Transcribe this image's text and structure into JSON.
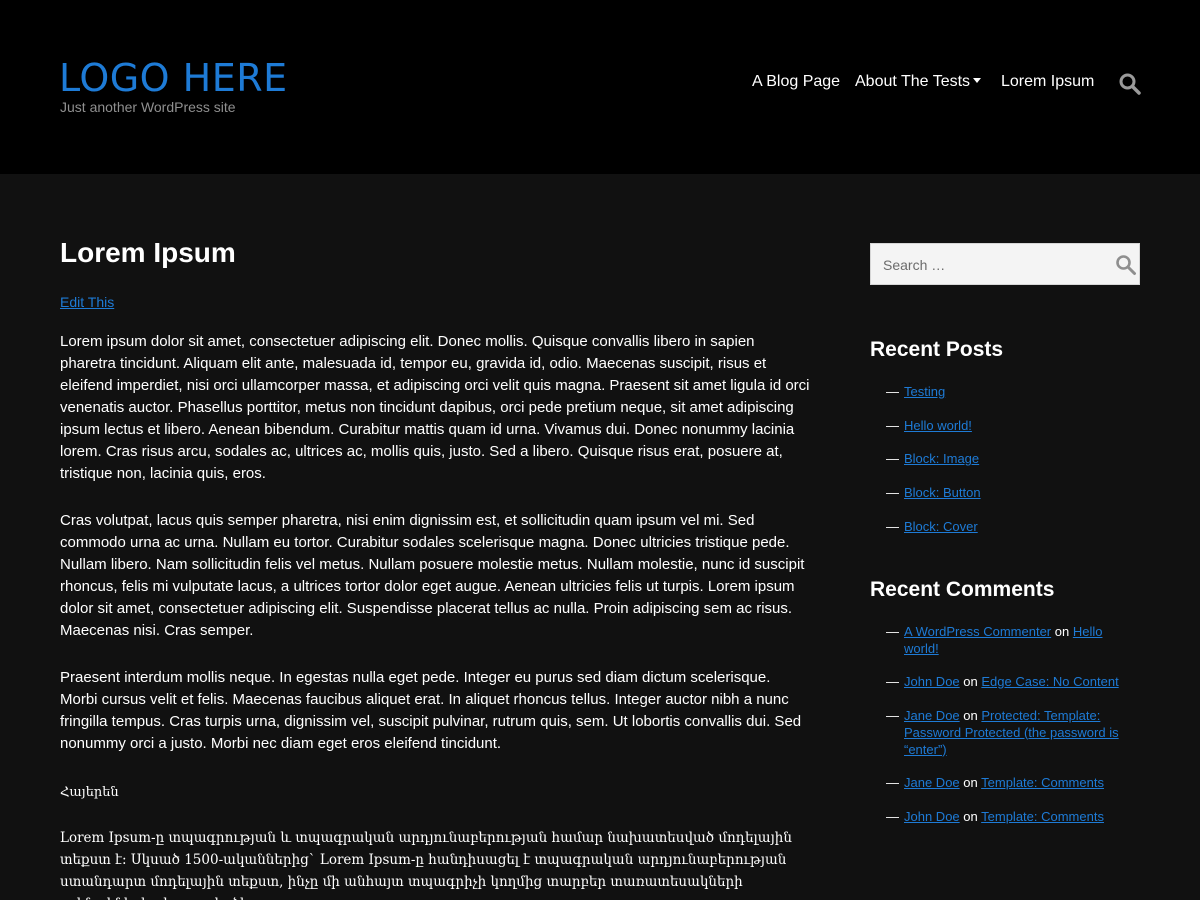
{
  "header": {
    "logo": "LOGO HERE",
    "tagline": "Just another WordPress site",
    "nav": [
      {
        "label": "A Blog Page"
      },
      {
        "label": "About The Tests"
      },
      {
        "label": "Lorem Ipsum"
      }
    ]
  },
  "main": {
    "title": "Lorem Ipsum",
    "edit_link": "Edit This",
    "paragraphs": [
      "Lorem ipsum dolor sit amet, consectetuer adipiscing elit. Donec mollis. Quisque convallis libero in sapien pharetra tincidunt. Aliquam elit ante, malesuada id, tempor eu, gravida id, odio. Maecenas suscipit, risus et eleifend imperdiet, nisi orci ullamcorper massa, et adipiscing orci velit quis magna. Praesent sit amet ligula id orci venenatis auctor. Phasellus porttitor, metus non tincidunt dapibus, orci pede pretium neque, sit amet adipiscing ipsum lectus et libero. Aenean bibendum. Curabitur mattis quam id urna. Vivamus dui. Donec nonummy lacinia lorem. Cras risus arcu, sodales ac, ultrices ac, mollis quis, justo. Sed a libero. Quisque risus erat, posuere at, tristique non, lacinia quis, eros.",
      "Cras volutpat, lacus quis semper pharetra, nisi enim dignissim est, et sollicitudin quam ipsum vel mi. Sed commodo urna ac urna. Nullam eu tortor. Curabitur sodales scelerisque magna. Donec ultricies tristique pede. Nullam libero. Nam sollicitudin felis vel metus. Nullam posuere molestie metus. Nullam molestie, nunc id suscipit rhoncus, felis mi vulputate lacus, a ultrices tortor dolor eget augue. Aenean ultricies felis ut turpis. Lorem ipsum dolor sit amet, consectetuer adipiscing elit. Suspendisse placerat tellus ac nulla. Proin adipiscing sem ac risus. Maecenas nisi. Cras semper.",
      "Praesent interdum mollis neque. In egestas nulla eget pede. Integer eu purus sed diam dictum scelerisque. Morbi cursus velit et felis. Maecenas faucibus aliquet erat. In aliquet rhoncus tellus. Integer auctor nibh a nunc fringilla tempus. Cras turpis urna, dignissim vel, suscipit pulvinar, rutrum quis, sem. Ut lobortis convallis dui. Sed nonummy orci a justo. Morbi nec diam eget eros eleifend tincidunt."
    ],
    "armenian_heading": "Հայերեն",
    "armenian_paragraph": "Lorem Ipsum-ը տպագրության և տպագրական արդյունաբերության համար նախատեսված մոդելային տեքստ է: Սկսած 1500-ականներից` Lorem Ipsum-ը հանդիսացել է տպագրական արդյունաբերության ստանդարտ մոդելային տեքստ, ինչը մի անհայտ տպագրիչի կողմից տարբեր տառատեսակների օրինակների գիրք ստեղծելու"
  },
  "sidebar": {
    "search_placeholder": "Search …",
    "recent_posts_title": "Recent Posts",
    "recent_posts": [
      {
        "label": "Testing"
      },
      {
        "label": "Hello world!"
      },
      {
        "label": "Block: Image"
      },
      {
        "label": "Block: Button"
      },
      {
        "label": "Block: Cover"
      }
    ],
    "recent_comments_title": "Recent Comments",
    "recent_comments": [
      {
        "author": "A WordPress Commenter",
        "on": "on",
        "post": "Hello world!"
      },
      {
        "author": "John Doe",
        "on": "on",
        "post": "Edge Case: No Content"
      },
      {
        "author": "Jane Doe",
        "on": "on",
        "post": "Protected: Template: Password Protected (the password is “enter”)"
      },
      {
        "author": "Jane Doe",
        "on": "on",
        "post": "Template: Comments"
      },
      {
        "author": "John Doe",
        "on": "on",
        "post": "Template: Comments"
      }
    ]
  },
  "colors": {
    "accent": "#1e7bd6",
    "header_bg": "#000000",
    "page_bg": "#111111"
  }
}
